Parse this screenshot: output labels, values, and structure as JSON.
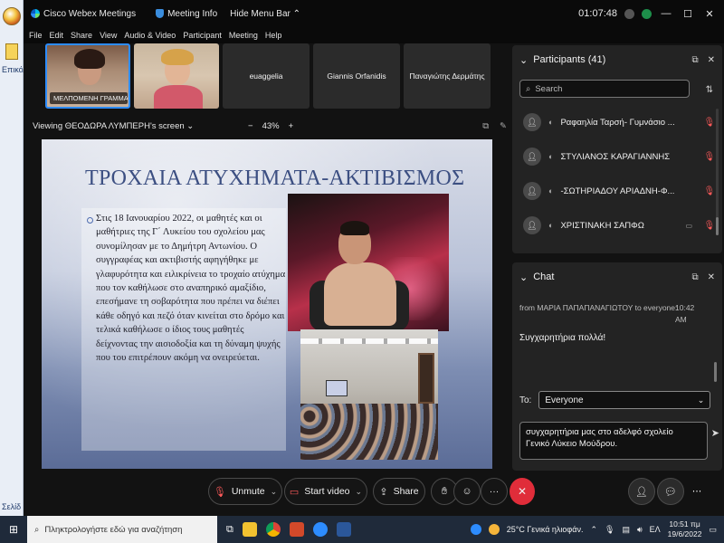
{
  "background_app": {
    "label": "Επικόλ",
    "status": "Σελίδ"
  },
  "titlebar": {
    "app_name": "Cisco Webex Meetings",
    "meeting_info": "Meeting Info",
    "hide_menu": "Hide Menu Bar ⌃",
    "time": "01:07:48",
    "minimize": "—",
    "maximize": "☐",
    "close": "✕"
  },
  "menu": [
    "File",
    "Edit",
    "Share",
    "View",
    "Audio & Video",
    "Participant",
    "Meeting",
    "Help"
  ],
  "thumbnails": [
    {
      "name": "ΜΕΛΠΟΜΕΝΗ ΓΡΑΜΜΑΤ..."
    },
    {
      "name": ""
    },
    {
      "name": "euaggelia"
    },
    {
      "name": "Giannis Orfanidis"
    },
    {
      "name": "Παναγιώτης Δερμάτης"
    }
  ],
  "share": {
    "viewing": "Viewing ΘΕΟΔΩΡΑ ΛΥΜΠΕΡΗ's screen ⌄",
    "zoom_minus": "−",
    "zoom": "43%",
    "zoom_plus": "+"
  },
  "slide": {
    "title": "ΤΡΟΧΑΙΑ ΑΤΥΧΗΜΑΤΑ-ΑΚΤΙΒΙΣΜΟΣ",
    "body": "Στις 18 Ιανουαρίου 2022, οι μαθητές και οι μαθήτριες της Γ΄ Λυκείου του σχολείου μας συνομίλησαν με το Δημήτρη Αντωνίου. Ο συγγραφέας και ακτιβιστής αφηγήθηκε με γλαφυρότητα και ειλικρίνεια το τροχαίο ατύχημα που τον καθήλωσε στο αναπηρικό αμαξίδιο, επεσήμανε τη σοβαρότητα που πρέπει να διέπει κάθε οδηγό και πεζό όταν κινείται στο δρόμο και τελικά καθήλωσε ο ίδιος τους μαθητές δείχνοντας την αισιοδοξία και τη δύναμη ψυχής που του επιτρέπουν ακόμη να ονειρεύεται."
  },
  "controls": {
    "unmute": "Unmute",
    "start_video": "Start video",
    "share": "Share",
    "more": "···",
    "end": "✕"
  },
  "participants": {
    "title": "Participants (41)",
    "search_placeholder": "Search",
    "list": [
      {
        "name": "Ραφαηλία Ταρσή- Γυμνάσιο ..."
      },
      {
        "name": "ΣΤΥΛΙΑΝΟΣ ΚΑΡΑΓΙΑΝΝΗΣ"
      },
      {
        "name": "-ΣΩΤΗΡΙΑΔΟΥ ΑΡΙΑΔΝΗ-Φ..."
      },
      {
        "name": "ΧΡΙΣΤΙΝΑΚΗ ΣΑΠΦΩ"
      }
    ]
  },
  "chat": {
    "title": "Chat",
    "message_meta": "from ΜΑΡΙΑ ΠΑΠΑΠΑΝΑΓΙΩΤΟΥ to everyone:",
    "message_time": "10:42 AM",
    "message_text": "Συγχαρητήρια πολλά!",
    "to_label": "To:",
    "to_value": "Everyone",
    "compose_line1": "συγχαρητήρια μας στο αδελφό σχολείο",
    "compose_line2": "Γενικό Λύκειο Μούδρου."
  },
  "taskbar": {
    "search_placeholder": "Πληκτρολογήστε εδώ για αναζήτηση",
    "weather": "25°C  Γενικά ηλιοφάν.",
    "lang": "ΕΛ",
    "time": "10:51 πμ",
    "date": "19/6/2022"
  },
  "colors": {
    "accent": "#2d8cff",
    "end_call": "#e02d3a",
    "muted": "#ff5a5a",
    "slide_title": "#3c4f82"
  }
}
